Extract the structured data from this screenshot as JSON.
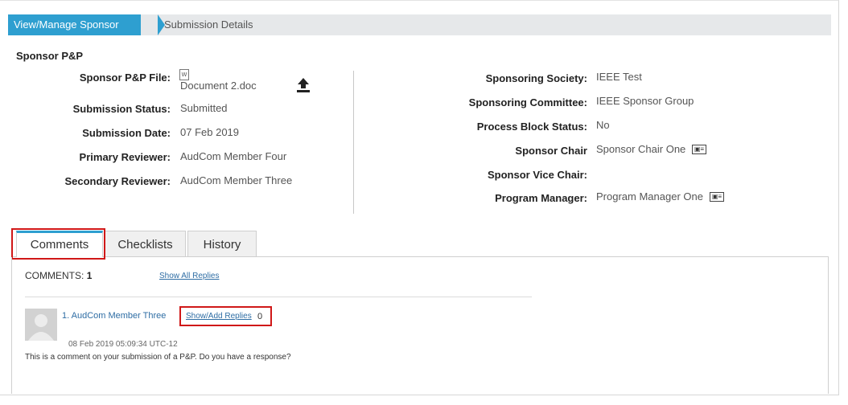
{
  "breadcrumb": {
    "items": [
      "View/Manage Sponsor P&Ps",
      "Submission Details"
    ]
  },
  "section_title": "Sponsor P&P",
  "left_fields": {
    "file_label": "Sponsor P&P File:",
    "file_name": "Document 2.doc",
    "status_label": "Submission Status:",
    "status_value": "Submitted",
    "date_label": "Submission Date:",
    "date_value": "07 Feb 2019",
    "primary_label": "Primary Reviewer:",
    "primary_value": "AudCom Member Four",
    "secondary_label": "Secondary Reviewer:",
    "secondary_value": "AudCom Member Three"
  },
  "right_fields": {
    "society_label": "Sponsoring Society:",
    "society_value": "IEEE Test",
    "committee_label": "Sponsoring Committee:",
    "committee_value": "IEEE Sponsor Group",
    "block_label": "Process Block Status:",
    "block_value": "No",
    "chair_label": "Sponsor Chair",
    "chair_value": "Sponsor Chair One",
    "vice_label": "Sponsor Vice Chair:",
    "vice_value": "",
    "pm_label": "Program Manager:",
    "pm_value": "Program Manager One"
  },
  "tabs": [
    {
      "label": "Comments"
    },
    {
      "label": "Checklists"
    },
    {
      "label": "History"
    }
  ],
  "comments": {
    "count_label": "COMMENTS:",
    "count": "1",
    "show_all": "Show All Replies",
    "item": {
      "author": "1. AudCom Member Three",
      "show_add": "Show/Add Replies",
      "reply_count": "0",
      "timestamp": "08 Feb 2019 05:09:34 UTC-12",
      "text": "This is a comment on your submission of a P&P. Do you have a response?"
    }
  },
  "colors": {
    "accent": "#2e9fd0",
    "highlight": "#d01818",
    "link": "#2e6da4"
  },
  "icons": [
    "word-doc-icon",
    "upload-icon",
    "contact-card-icon",
    "avatar-placeholder"
  ]
}
